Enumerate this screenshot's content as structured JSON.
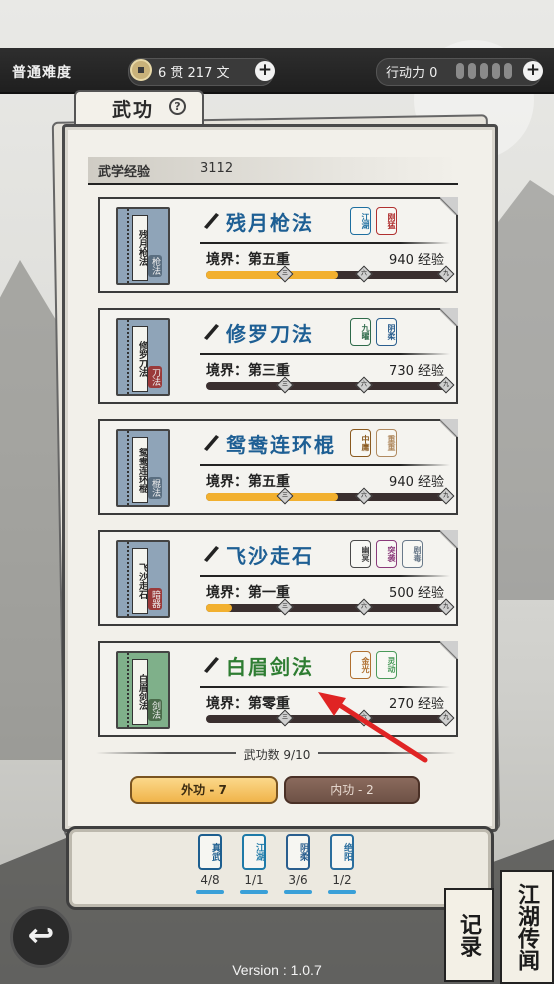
{
  "header": {
    "difficulty": "普通难度",
    "money": "6 贯  217  文",
    "stamina": "行动力 0",
    "colors": {
      "bar": "#262626",
      "pip": "#8a8a8a"
    }
  },
  "panel": {
    "tab_title": "武功",
    "exp_label": "武学经验",
    "exp_value": "3112",
    "skill_count": "武功数 9/10",
    "outer_tab": "外功 - 7",
    "inner_tab": "内功 - 2"
  },
  "skills": [
    {
      "name": "残月枪法",
      "book_label": "残月枪法",
      "seal": "枪法",
      "realm": "境界：第五重",
      "xp": "940 经验",
      "progress": 0.55,
      "name_color": "#1e5f94",
      "book_color": "#8fa4b8",
      "seal_color": "#5a6e80",
      "tags": [
        {
          "text": "江湖",
          "color": "#1e6fa0"
        },
        {
          "text": "刚猛",
          "color": "#b03030"
        }
      ]
    },
    {
      "name": "修罗刀法",
      "book_label": "修罗刀法",
      "seal": "刀法",
      "realm": "境界：第三重",
      "xp": "730 经验",
      "progress": 0.0,
      "name_color": "#1e5f94",
      "book_color": "#8fa4b8",
      "seal_color": "#9a3a3a",
      "tags": [
        {
          "text": "九曜",
          "color": "#2e6a4a"
        },
        {
          "text": "阴柔",
          "color": "#2a5e8e"
        }
      ]
    },
    {
      "name": "鸳鸯连环棍",
      "book_label": "鸳鸯连环棍",
      "seal": "棍法",
      "realm": "境界：第五重",
      "xp": "940 经验",
      "progress": 0.55,
      "name_color": "#1e5f94",
      "book_color": "#8fa4b8",
      "seal_color": "#5a6e80",
      "tags": [
        {
          "text": "中庸",
          "color": "#8a5a20"
        },
        {
          "text": "重重",
          "color": "#b08a60"
        }
      ]
    },
    {
      "name": "飞沙走石",
      "book_label": "飞沙走石",
      "seal": "暗器",
      "realm": "境界：第一重",
      "xp": "500 经验",
      "progress": 0.11,
      "name_color": "#1e5f94",
      "book_color": "#8fa4b8",
      "seal_color": "#9a3a3a",
      "tags": [
        {
          "text": "幽冥",
          "color": "#4a4a4a"
        },
        {
          "text": "突袭",
          "color": "#8a3a7a"
        },
        {
          "text": "剧毒",
          "color": "#6a7a8a"
        }
      ]
    },
    {
      "name": "白眉剑法",
      "book_label": "白眉剑法",
      "seal": "剑法",
      "realm": "境界：第零重",
      "xp": "270 经验",
      "progress": 0.0,
      "name_color": "#2e7d32",
      "book_color": "#7fb08a",
      "seal_color": "#4a6a4a",
      "tags": [
        {
          "text": "金光",
          "color": "#b07030"
        },
        {
          "text": "灵动",
          "color": "#4a9a5a"
        }
      ]
    }
  ],
  "traits": [
    {
      "label": "真武",
      "count": "4/8",
      "color": "#1d5e8f"
    },
    {
      "label": "江湖",
      "count": "1/1",
      "color": "#1e7aa8"
    },
    {
      "label": "阴柔",
      "count": "3/6",
      "color": "#2a5e8e"
    },
    {
      "label": "绝阳",
      "count": "1/2",
      "color": "#2a6e9e"
    }
  ],
  "footer": {
    "back_icon": "back-arrow-icon",
    "version": "Version : 1.0.7",
    "scroll_records": "记录",
    "scroll_legend": "江湖传闻"
  }
}
